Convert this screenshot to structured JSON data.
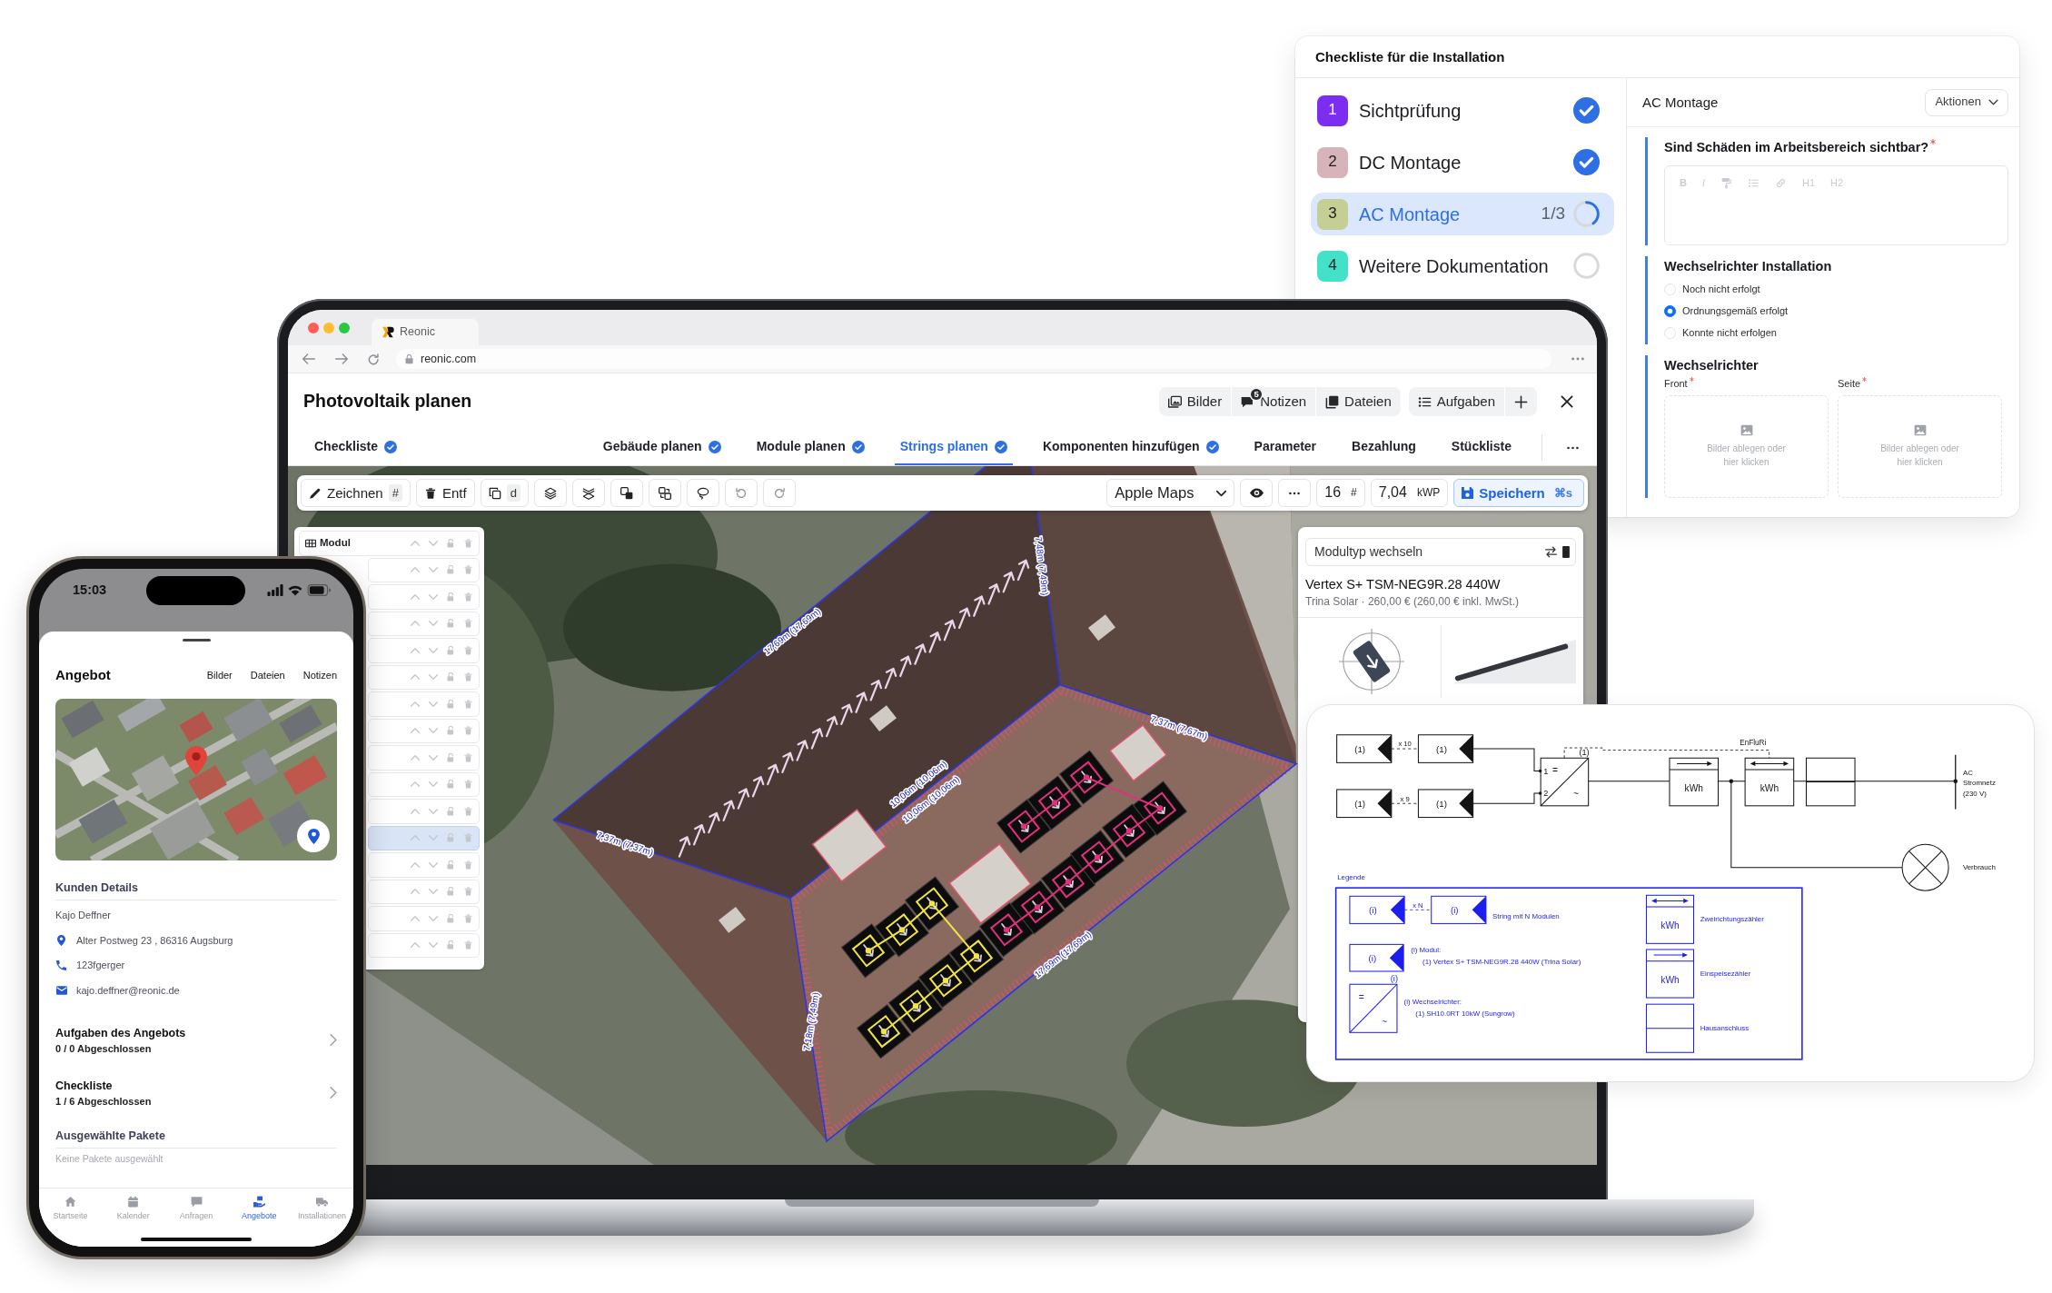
{
  "checklist_window": {
    "title": "Checkliste für die Installation",
    "steps": [
      {
        "number": "1",
        "label": "Sichtprüfung",
        "color": "#7c2df0",
        "kind": "done",
        "selected": false
      },
      {
        "number": "2",
        "label": "DC Montage",
        "color": "#d7b3ba",
        "kind": "done",
        "selected": false
      },
      {
        "number": "3",
        "label": "AC Montage",
        "color": "#c5ce95",
        "kind": "in_progress",
        "progress": "1/3",
        "selected": true
      },
      {
        "number": "4",
        "label": "Weitere Dokumentation",
        "color": "#42e1c8",
        "kind": "open",
        "selected": false
      }
    ],
    "detail": {
      "title": "AC Montage",
      "actions_button": "Aktionen",
      "questions": [
        {
          "kind": "rich_text",
          "label": "Sind Schäden im Arbeitsbereich sichtbar?",
          "required": true,
          "toolbar": {
            "disabled": true,
            "tools": [
              {
                "kind": "text",
                "label": "B"
              },
              {
                "kind": "text",
                "label": "I"
              },
              {
                "kind": "format_paint"
              },
              {
                "kind": "list"
              },
              {
                "kind": "link"
              },
              {
                "kind": "text",
                "label": "H1"
              },
              {
                "kind": "text",
                "label": "H2"
              }
            ]
          }
        },
        {
          "kind": "radio",
          "label": "Wechselrichter Installation",
          "required": false,
          "options": [
            {
              "label": "Noch nicht erfolgt",
              "selected": false
            },
            {
              "label": "Ordnungsgemäß erfolgt",
              "selected": true
            },
            {
              "label": "Konnte nicht erfolgen",
              "selected": false
            }
          ]
        },
        {
          "kind": "photos",
          "label": "Wechselrichter",
          "required": false,
          "fields": [
            {
              "label": "Front",
              "required": true,
              "hint": "Bilder ablegen oder hier klicken"
            },
            {
              "label": "Seite",
              "required": true,
              "hint": "Bilder ablegen oder hier klicken"
            }
          ]
        }
      ]
    }
  },
  "laptop": {
    "browser": {
      "tab_title": "Reonic",
      "url": "reonic.com"
    },
    "app": {
      "title": "Photovoltaik planen",
      "header_groups": [
        [
          {
            "kind": "images",
            "label": "Bilder"
          },
          {
            "kind": "notes",
            "label": "Notizen",
            "badge": "5"
          },
          {
            "kind": "files",
            "label": "Dateien"
          }
        ],
        [
          {
            "kind": "tasks",
            "label": "Aufgaben"
          },
          {
            "kind": "add"
          }
        ]
      ],
      "tabs": [
        {
          "label": "Checkliste",
          "done": true,
          "selected": false
        },
        {
          "label": "Gebäude planen",
          "done": true,
          "selected": false
        },
        {
          "label": "Module planen",
          "done": true,
          "selected": false
        },
        {
          "label": "Strings planen",
          "done": true,
          "selected": true
        },
        {
          "label": "Komponenten hinzufügen",
          "done": true,
          "selected": false
        },
        {
          "label": "Parameter",
          "done": false,
          "selected": false
        },
        {
          "label": "Bezahlung",
          "done": false,
          "selected": false
        },
        {
          "label": "Stückliste",
          "done": false,
          "selected": false
        }
      ],
      "toolbar": {
        "tools": [
          {
            "kind": "draw",
            "label": "Zeichnen",
            "shortcut": "#"
          },
          {
            "kind": "delete",
            "label": "Entf"
          },
          {
            "kind": "copy",
            "shortcut": "d"
          },
          {
            "kind": "bring_forward"
          },
          {
            "kind": "send_backward"
          },
          {
            "kind": "group"
          },
          {
            "kind": "ungroup"
          },
          {
            "kind": "lasso"
          },
          {
            "kind": "undo"
          },
          {
            "kind": "redo"
          }
        ],
        "map_source": "Apple Maps",
        "module_count": "16",
        "module_count_unit": "#",
        "power": "7,04",
        "power_unit": "kWP",
        "save": {
          "label": "Speichern",
          "shortcut": "⌘s"
        }
      },
      "module_list": {
        "rows": [
          {
            "label": "Modul",
            "selected": false
          },
          {
            "selected": false
          },
          {
            "selected": false
          },
          {
            "selected": false
          },
          {
            "selected": false
          },
          {
            "selected": false
          },
          {
            "selected": false
          },
          {
            "selected": false
          },
          {
            "selected": false
          },
          {
            "selected": false
          },
          {
            "selected": false
          },
          {
            "selected": true
          },
          {
            "selected": false
          },
          {
            "selected": false
          },
          {
            "selected": false
          },
          {
            "selected": false
          }
        ]
      },
      "module_panel": {
        "select_label": "Modultyp wechseln",
        "model": "Vertex S+ TSM-NEG9R.28 440W",
        "details": "Trina Solar · 260,00 € (260,00 € inkl. MwSt.)"
      },
      "map": {
        "dimension_labels": [
          "17,69m (17,69m)",
          "7,48m (7,49m)",
          "10,06m (10,06m)",
          "10,06m (10,06m)",
          "7,37m (7,37m)",
          "7,37m (7,67m)",
          "17,69m (17,69m)",
          "7,18m (7,49m)"
        ]
      }
    }
  },
  "wiring_diagram": {
    "strings": [
      {
        "first_module": "(1)",
        "count": "x 10",
        "last_module": "(1)",
        "input": "1"
      },
      {
        "first_module": "(1)",
        "count": "x 9",
        "last_module": "(1)",
        "input": "2"
      }
    ],
    "inverter": {
      "label": "(1)",
      "dc_symbol": "=",
      "ac_symbol": "~"
    },
    "control_line_label": "EnFluRi",
    "meters": [
      {
        "kind": "feed_in",
        "unit": "kWh"
      },
      {
        "kind": "bidirectional",
        "unit": "kWh"
      },
      {
        "kind": "house_connection"
      }
    ],
    "grid_label": [
      "AC",
      "Stromnetz",
      "(230 V)"
    ],
    "consumer_label": "Verbrauch",
    "legend": {
      "title": "Legende",
      "string": {
        "first_module": "(i)",
        "count": "x N",
        "last_module": "(i)",
        "text": "String mit N Modulen"
      },
      "module": {
        "label": "(i)",
        "title": "(i) Modul:",
        "detail": "(1) Vertex S+ TSM-NEG9R.28 440W (Trina Solar)"
      },
      "inverter": {
        "label": "(i)",
        "dc_symbol": "=",
        "ac_symbol": "~",
        "title": "(i) Wechselrichter:",
        "detail": "(1) SH10.0RT 10kW (Sungrow)"
      },
      "meters": [
        {
          "kind": "bidirectional",
          "unit": "kWh",
          "text": "Zweirichtungszähler"
        },
        {
          "kind": "feed_in",
          "unit": "kWh",
          "text": "Einspeisezähler"
        },
        {
          "kind": "house_connection",
          "text": "Hausanschluss"
        }
      ]
    }
  },
  "phone": {
    "time": "15:03",
    "sheet": {
      "title": "Angebot",
      "links": [
        "Bilder",
        "Dateien",
        "Notizen"
      ],
      "customer": {
        "heading": "Kunden Details",
        "name": "Kajo Deffner",
        "contacts": [
          {
            "kind": "address",
            "text": "Alter Postweg 23 , 86316 Augsburg"
          },
          {
            "kind": "phone",
            "text": "123fgerger"
          },
          {
            "kind": "email",
            "text": "kajo.deffner@reonic.de"
          }
        ]
      },
      "summaries": [
        {
          "title": "Aufgaben des Angebots",
          "status": "0 / 0 Abgeschlossen"
        },
        {
          "title": "Checkliste",
          "status": "1 / 6 Abgeschlossen"
        }
      ],
      "packages": {
        "heading": "Ausgewählte Pakete",
        "empty_text": "Keine Pakete ausgewählt"
      }
    },
    "tab_bar": [
      {
        "kind": "home",
        "label": "Startseite",
        "selected": false
      },
      {
        "kind": "calendar",
        "label": "Kalender",
        "selected": false
      },
      {
        "kind": "requests",
        "label": "Anfragen",
        "selected": false
      },
      {
        "kind": "offers",
        "label": "Angebote",
        "selected": true
      },
      {
        "kind": "installations",
        "label": "Installationen",
        "selected": false
      }
    ]
  }
}
